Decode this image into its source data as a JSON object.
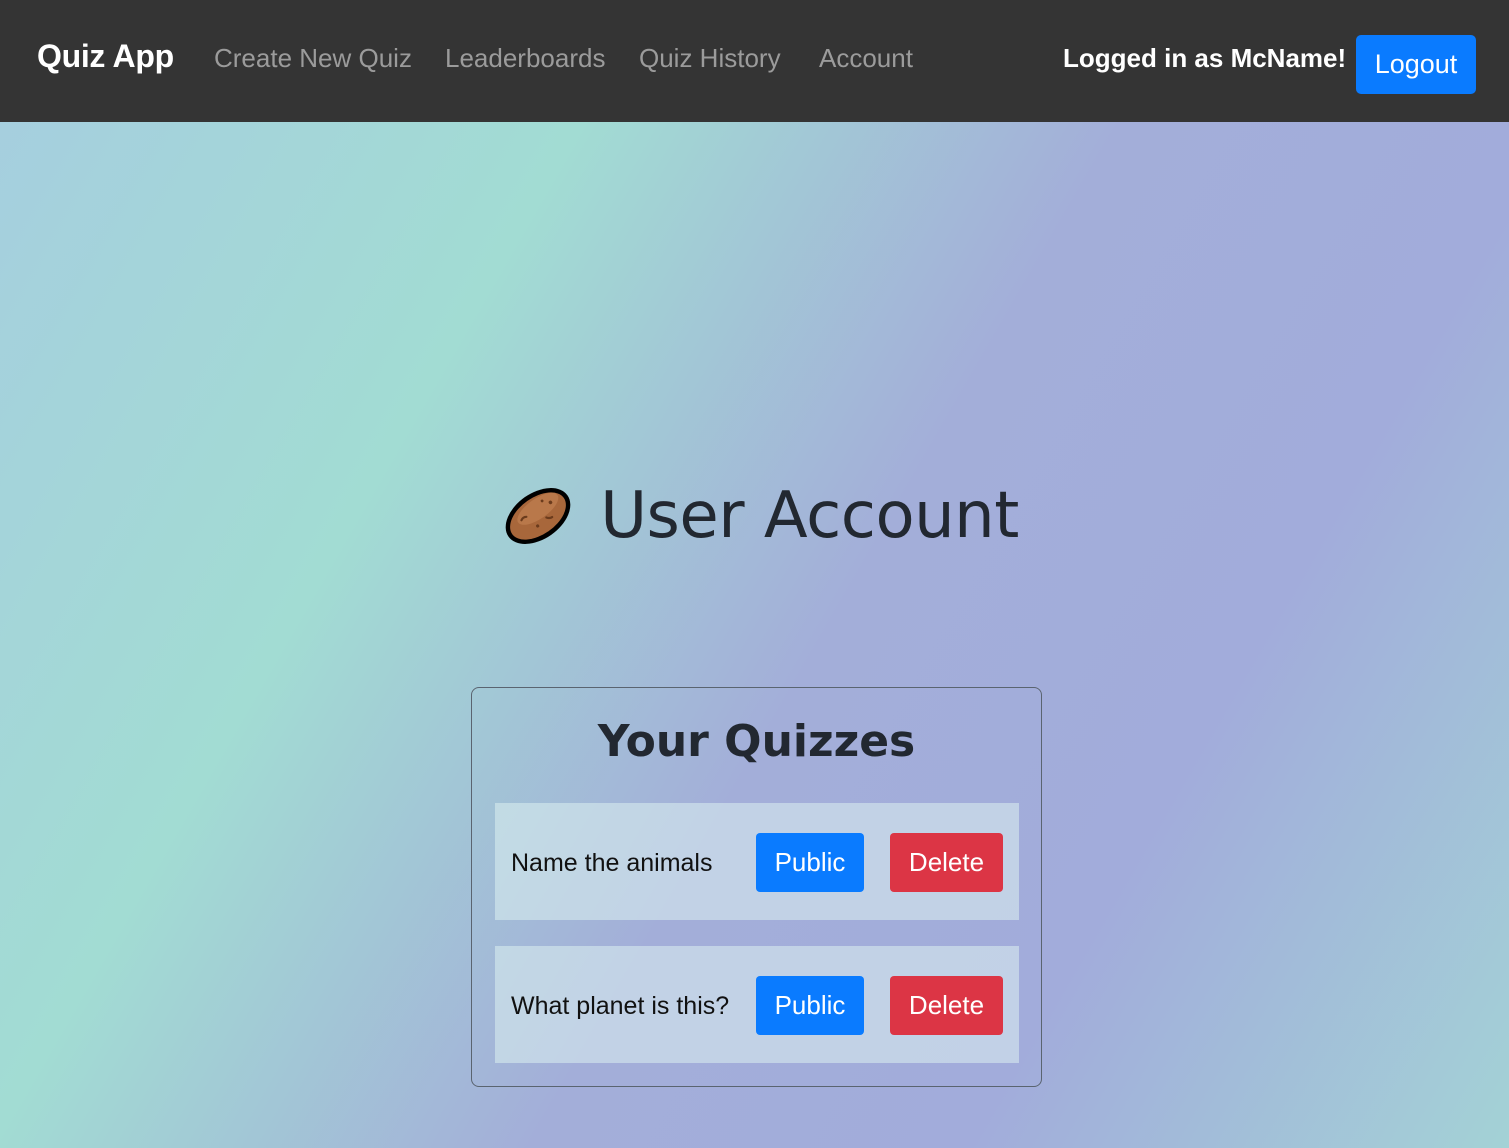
{
  "navbar": {
    "brand": "Quiz App",
    "links": [
      {
        "label": "Create New Quiz"
      },
      {
        "label": "Leaderboards"
      },
      {
        "label": "Quiz History"
      },
      {
        "label": "Account"
      }
    ],
    "user_status": "Logged in as McName!",
    "logout_label": "Logout"
  },
  "page": {
    "icon": "potato-icon",
    "title": "User Account"
  },
  "quizzes_card": {
    "title": "Your Quizzes",
    "items": [
      {
        "name": "Name the animals",
        "public_label": "Public",
        "delete_label": "Delete"
      },
      {
        "name": "What planet is this?",
        "public_label": "Public",
        "delete_label": "Delete"
      }
    ]
  },
  "colors": {
    "navbar_bg": "#343434",
    "primary": "#0a7bff",
    "danger": "#dc3545",
    "nav_link": "#9b9b9b"
  }
}
